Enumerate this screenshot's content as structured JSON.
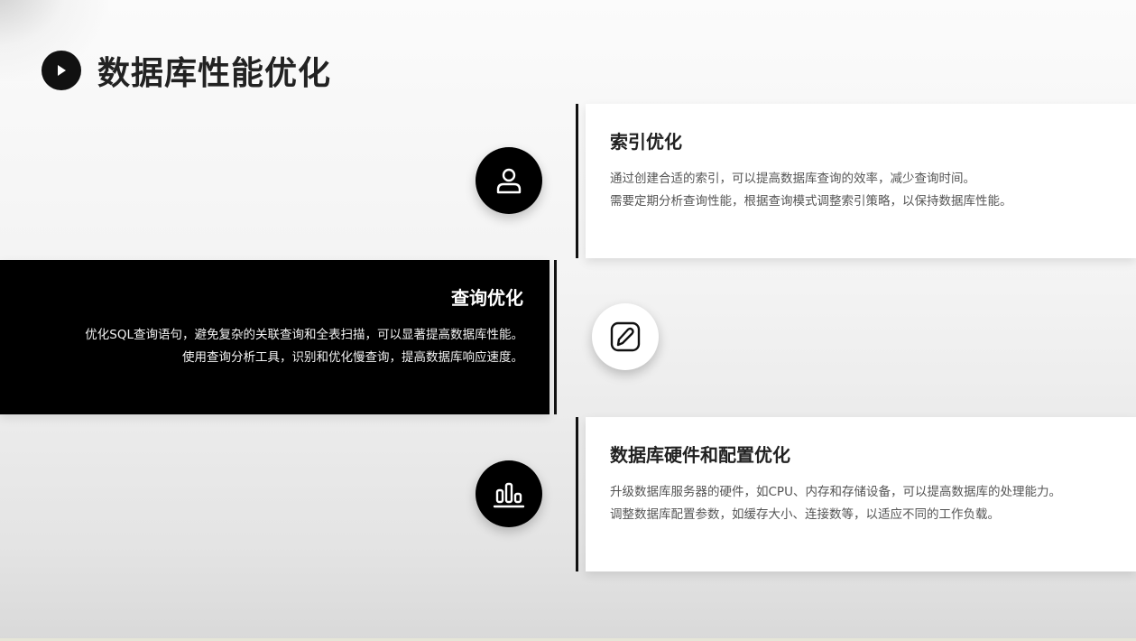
{
  "slide": {
    "title": "数据库性能优化",
    "sections": [
      {
        "heading": "索引优化",
        "lines": [
          "通过创建合适的索引，可以提高数据库查询的效率，减少查询时间。",
          "需要定期分析查询性能，根据查询模式调整索引策略，以保持数据库性能。"
        ],
        "icon": "user-icon"
      },
      {
        "heading": "查询优化",
        "lines": [
          "优化SQL查询语句，避免复杂的关联查询和全表扫描，可以显著提高数据库性能。",
          "使用查询分析工具，识别和优化慢查询，提高数据库响应速度。"
        ],
        "icon": "edit-icon"
      },
      {
        "heading": "数据库硬件和配置优化",
        "lines": [
          "升级数据库服务器的硬件，如CPU、内存和存储设备，可以提高数据库的处理能力。",
          "调整数据库配置参数，如缓存大小、连接数等，以适应不同的工作负载。"
        ],
        "icon": "bar-chart-icon"
      }
    ]
  },
  "colors": {
    "primary": "#000000",
    "card": "#ffffff",
    "text": "#222222",
    "muted": "#555555"
  }
}
